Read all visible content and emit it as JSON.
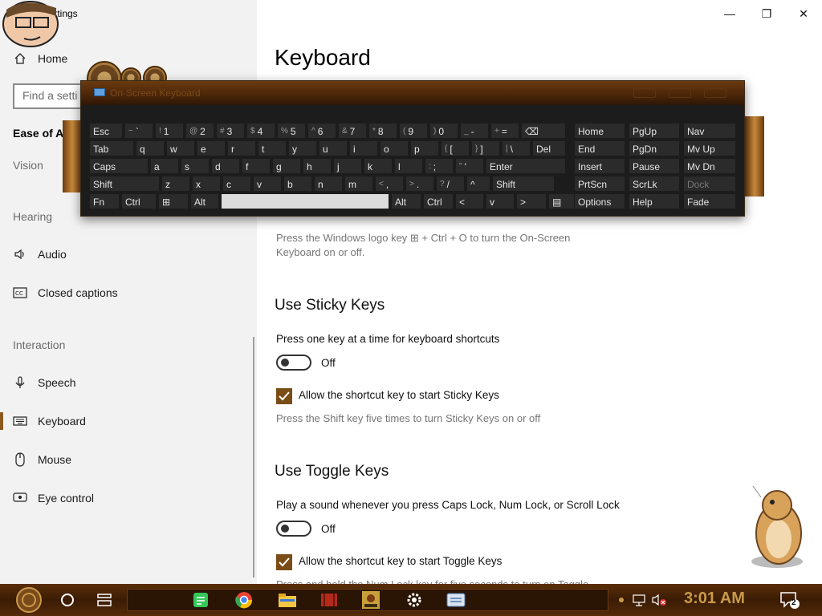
{
  "window": {
    "title": "ttings",
    "minimize_glyph": "—",
    "maximize_glyph": "❐",
    "close_glyph": "✕"
  },
  "sidebar": {
    "home_label": "Home",
    "search_placeholder": "Find a setti",
    "category_title": "Ease of Acces",
    "groups": {
      "vision": "Vision",
      "hearing": "Hearing",
      "interaction": "Interaction"
    },
    "items": [
      {
        "label": "Audio",
        "icon": "speaker-icon"
      },
      {
        "label": "Closed captions",
        "icon": "cc-icon"
      },
      {
        "label": "Speech",
        "icon": "microphone-icon"
      },
      {
        "label": "Keyboard",
        "icon": "keyboard-icon"
      },
      {
        "label": "Mouse",
        "icon": "mouse-icon"
      },
      {
        "label": "Eye control",
        "icon": "eye-control-icon"
      }
    ],
    "selected": "Keyboard"
  },
  "main": {
    "title": "Keyboard",
    "osk_hint": "Press the Windows logo key ⊞ + Ctrl + O to turn the On-Screen Keyboard on or off.",
    "sticky": {
      "heading": "Use Sticky Keys",
      "desc": "Press one key at a time for keyboard shortcuts",
      "toggle_state": "Off",
      "checkbox_label": "Allow the shortcut key to start Sticky Keys",
      "checkbox_checked": true,
      "hint": "Press the Shift key five times to turn Sticky Keys on or off"
    },
    "toggle_keys": {
      "heading": "Use Toggle Keys",
      "desc": "Play a sound whenever you press Caps Lock, Num Lock, or Scroll Lock",
      "toggle_state": "Off",
      "checkbox_label": "Allow the shortcut key to start Toggle Keys",
      "checkbox_checked": true,
      "hint_partial": "Press and hold the Num Lock key for five seconds to turn on Toggle"
    }
  },
  "osk": {
    "title": "On-Screen Keyboard",
    "row1": [
      "Esc",
      "~ `",
      "! 1",
      "@ 2",
      "# 3",
      "$ 4",
      "% 5",
      "^ 6",
      "& 7",
      "* 8",
      "( 9",
      ") 0",
      "_ -",
      "+ =",
      "⌫"
    ],
    "row2": [
      "Tab",
      "q",
      "w",
      "e",
      "r",
      "t",
      "y",
      "u",
      "i",
      "o",
      "p",
      "{ [",
      "} ]",
      "| \\",
      "Del"
    ],
    "row3": [
      "Caps",
      "a",
      "s",
      "d",
      "f",
      "g",
      "h",
      "j",
      "k",
      "l",
      ": ;",
      "\" '",
      "Enter"
    ],
    "row4": [
      "Shift",
      "z",
      "x",
      "c",
      "v",
      "b",
      "n",
      "m",
      "< ,",
      "> .",
      "? /",
      "^",
      "Shift"
    ],
    "row5": [
      "Fn",
      "Ctrl",
      "⊞",
      "Alt",
      "",
      "Alt",
      "Ctrl",
      "<",
      "v",
      ">",
      "▤"
    ],
    "nav": [
      [
        "Home",
        "PgUp",
        "Nav"
      ],
      [
        "End",
        "PgDn",
        "Mv Up"
      ],
      [
        "Insert",
        "Pause",
        "Mv Dn"
      ],
      [
        "PrtScn",
        "ScrLk",
        "Dock"
      ],
      [
        "Options",
        "Help",
        "Fade"
      ]
    ]
  },
  "taskbar": {
    "clock": "3:01 AM",
    "notification_count": "2",
    "icons": [
      "start-icon",
      "cortana-icon",
      "task-view-icon",
      "notes-icon",
      "chrome-icon",
      "file-explorer-icon",
      "media-icon",
      "game-icon",
      "settings-icon",
      "osk-taskbar-icon"
    ],
    "accent": "#c89a4a"
  }
}
